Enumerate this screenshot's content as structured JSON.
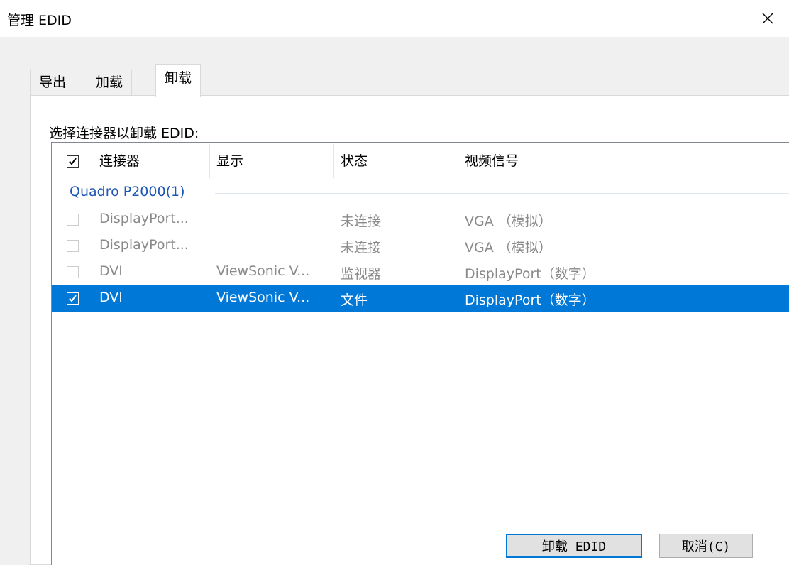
{
  "window": {
    "title": "管理 EDID",
    "close_icon": "close-icon"
  },
  "tabs": [
    {
      "label": "导出",
      "active": false
    },
    {
      "label": "加载",
      "active": false
    },
    {
      "label": "卸载",
      "active": true
    }
  ],
  "instruction": "选择连接器以卸载 EDID:",
  "table": {
    "columns": [
      "连接器",
      "显示",
      "状态",
      "视频信号"
    ],
    "header_checked": true,
    "group": "Quadro P2000(1)",
    "rows": [
      {
        "connector": "DisplayPort...",
        "display": "",
        "status": "未连接",
        "signal": "VGA （模拟）",
        "checked": false,
        "enabled": false,
        "selected": false
      },
      {
        "connector": "DisplayPort...",
        "display": "",
        "status": "未连接",
        "signal": "VGA （模拟）",
        "checked": false,
        "enabled": false,
        "selected": false
      },
      {
        "connector": "DVI",
        "display": "ViewSonic V...",
        "status": "监视器",
        "signal": "DisplayPort（数字）",
        "checked": false,
        "enabled": false,
        "selected": false
      },
      {
        "connector": "DVI",
        "display": "ViewSonic V...",
        "status": "文件",
        "signal": "DisplayPort（数字）",
        "checked": true,
        "enabled": true,
        "selected": true
      }
    ]
  },
  "buttons": {
    "unload": "卸载 EDID",
    "cancel": "取消(C)"
  },
  "colors": {
    "selection": "#0078d7",
    "group_text": "#1e56b5",
    "disabled_text": "#8a8a8a"
  }
}
